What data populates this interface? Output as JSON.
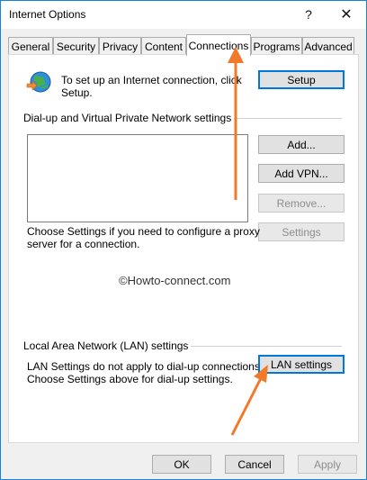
{
  "window": {
    "title": "Internet Options",
    "help_glyph": "?",
    "close_glyph": "✕"
  },
  "tabs": [
    {
      "label": "General"
    },
    {
      "label": "Security"
    },
    {
      "label": "Privacy"
    },
    {
      "label": "Content"
    },
    {
      "label": "Connections"
    },
    {
      "label": "Programs"
    },
    {
      "label": "Advanced"
    }
  ],
  "setup": {
    "text_line1": "To set up an Internet connection, click",
    "text_line2": "Setup.",
    "button": "Setup"
  },
  "dialup": {
    "group_label": "Dial-up and Virtual Private Network settings",
    "add_button": "Add...",
    "add_vpn_button": "Add VPN...",
    "remove_button": "Remove...",
    "settings_button": "Settings",
    "proxy_line1": "Choose Settings if you need to configure a proxy",
    "proxy_line2": "server for a connection."
  },
  "watermark": "©Howto-connect.com",
  "lan": {
    "group_label": "Local Area Network (LAN) settings",
    "line1": "LAN Settings do not apply to dial-up connections.",
    "line2": "Choose Settings above for dial-up settings.",
    "button": "LAN settings"
  },
  "footer": {
    "ok": "OK",
    "cancel": "Cancel",
    "apply": "Apply"
  },
  "colors": {
    "accent": "#0078d7",
    "arrow": "#f07a2a"
  }
}
